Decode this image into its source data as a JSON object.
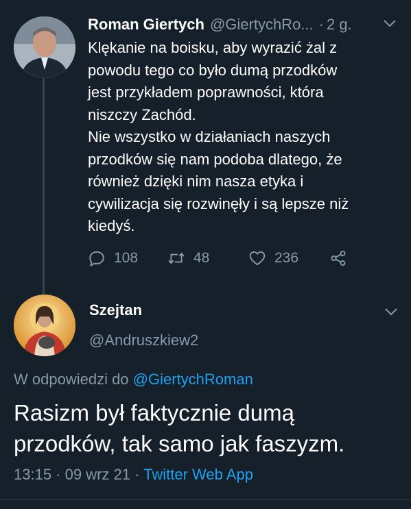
{
  "tweet": {
    "author_name": "Roman Giertych",
    "author_handle": "@GiertychRo...",
    "separator": "·",
    "time": "2 g.",
    "text": "Klękanie na boisku, aby wyrazić żal z\npowodu tego co było dumą przodków\njest przykładem poprawności, która\nniszczy Zachód.\nNie wszystko w działaniach naszych\nprzodków się nam podoba dlatego, że\nrównież dzięki nim nasza etyka i\ncywilizacja się rozwinęły i są lepsze niż\nkiedyś.",
    "reply_count": "108",
    "retweet_count": "48",
    "like_count": "236"
  },
  "reply": {
    "author_name": "Szejtan",
    "author_handle": "@Andruszkiew2",
    "in_reply_prefix": "W odpowiedzi do",
    "in_reply_handle": "@GiertychRoman",
    "text": "Rasizm był faktycznie dumą\nprzodków, tak samo jak faszyzm.",
    "timestamp": "13:15 · 09 wrz 21 ·",
    "source": "Twitter Web App"
  },
  "colors": {
    "background": "#15202b",
    "secondary_text": "#8899a6",
    "link": "#1da1f2",
    "divider": "#38444d"
  },
  "icons": [
    "reply-icon",
    "retweet-icon",
    "like-icon",
    "share-icon",
    "chevron-down-icon"
  ]
}
